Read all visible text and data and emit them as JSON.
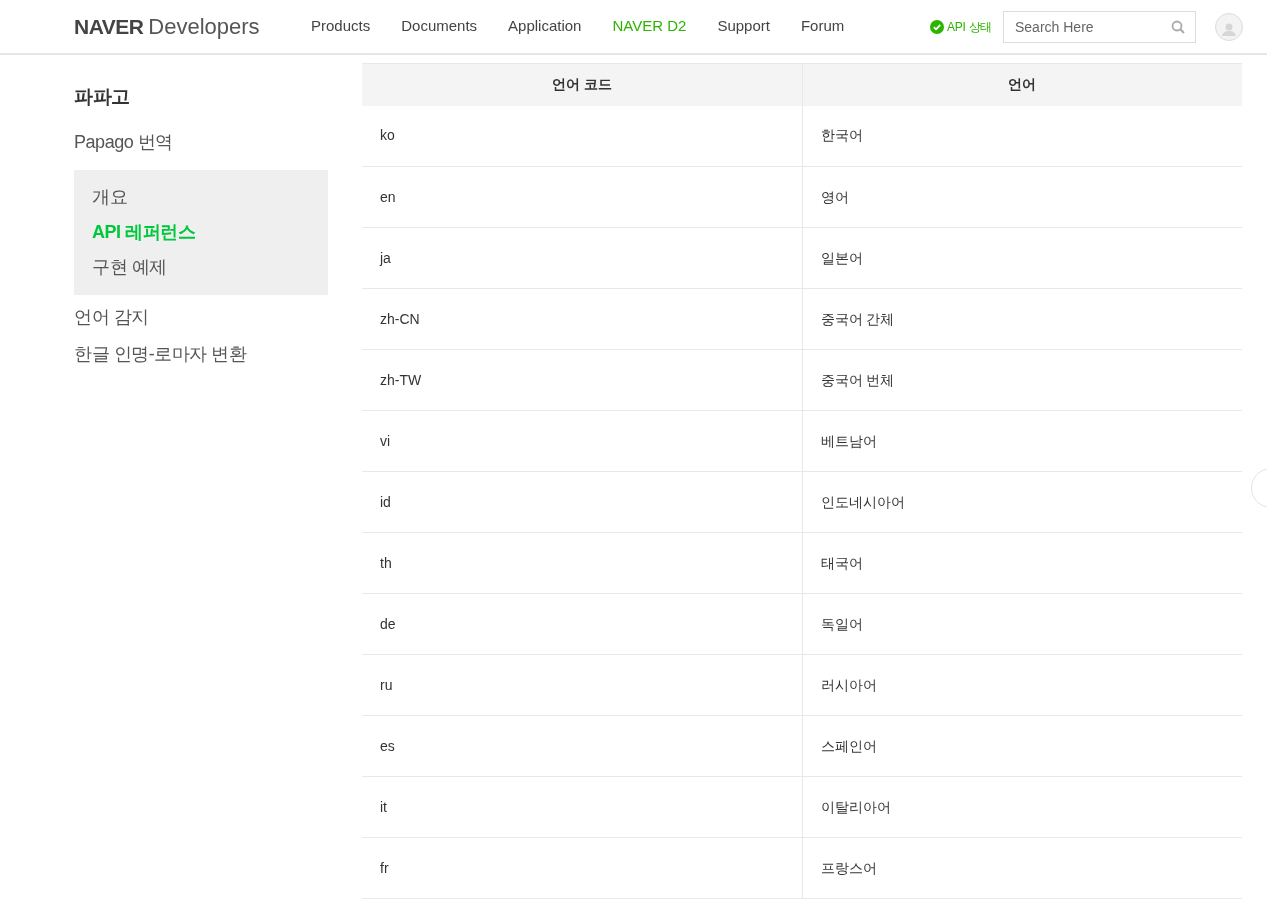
{
  "header": {
    "logo_bold": "NAVER",
    "logo_light": "Developers",
    "nav": [
      {
        "label": "Products",
        "highlighted": false
      },
      {
        "label": "Documents",
        "highlighted": false
      },
      {
        "label": "Application",
        "highlighted": false
      },
      {
        "label": "NAVER D2",
        "highlighted": true
      },
      {
        "label": "Support",
        "highlighted": false
      },
      {
        "label": "Forum",
        "highlighted": false
      }
    ],
    "api_status": "API 상태",
    "search": {
      "placeholder": "Search Here"
    }
  },
  "sidebar": {
    "title": "파파고",
    "items": [
      {
        "label": "Papago 번역",
        "selected": false,
        "children": [
          {
            "label": "개요",
            "selected": false
          },
          {
            "label": "API 레퍼런스",
            "selected": true
          },
          {
            "label": "구현 예제",
            "selected": false
          }
        ]
      },
      {
        "label": "언어 감지",
        "selected": false
      },
      {
        "label": "한글 인명-로마자 변환",
        "selected": false
      }
    ]
  },
  "table": {
    "columns": [
      "언어 코드",
      "언어"
    ],
    "rows": [
      [
        "ko",
        "한국어"
      ],
      [
        "en",
        "영어"
      ],
      [
        "ja",
        "일본어"
      ],
      [
        "zh-CN",
        "중국어 간체"
      ],
      [
        "zh-TW",
        "중국어 번체"
      ],
      [
        "vi",
        "베트남어"
      ],
      [
        "id",
        "인도네시아어"
      ],
      [
        "th",
        "태국어"
      ],
      [
        "de",
        "독일어"
      ],
      [
        "ru",
        "러시아어"
      ],
      [
        "es",
        "스페인어"
      ],
      [
        "it",
        "이탈리아어"
      ],
      [
        "fr",
        "프랑스어"
      ]
    ]
  }
}
